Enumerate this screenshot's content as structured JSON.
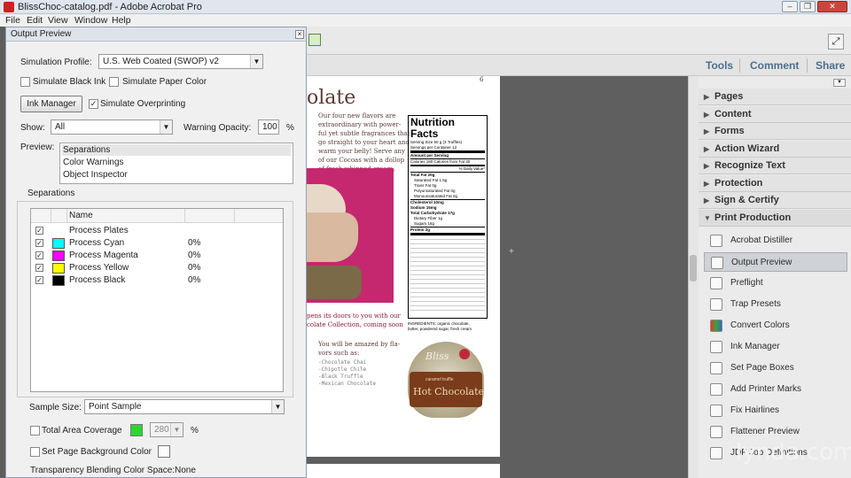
{
  "window": {
    "title": "BlissChoc-catalog.pdf - Adobe Acrobat Pro"
  },
  "menu": [
    "File",
    "Edit",
    "View",
    "Window",
    "Help"
  ],
  "command_bar": {
    "tools": "Tools",
    "comment": "Comment",
    "share": "Share"
  },
  "right_panel": {
    "sections": [
      "Pages",
      "Content",
      "Forms",
      "Action Wizard",
      "Recognize Text",
      "Protection",
      "Sign & Certify",
      "Print Production"
    ],
    "tools": [
      "Acrobat Distiller",
      "Output Preview",
      "Preflight",
      "Trap Presets",
      "Convert Colors",
      "Ink Manager",
      "Set Page Boxes",
      "Add Printer Marks",
      "Fix Hairlines",
      "Flattener Preview",
      "JDF Job Definitions"
    ],
    "selected_tool": "Output Preview"
  },
  "dialog": {
    "title": "Output Preview",
    "simulation_profile_label": "Simulation Profile:",
    "simulation_profile": "U.S. Web Coated (SWOP) v2",
    "simulate_black_ink": "Simulate Black Ink",
    "simulate_paper_color": "Simulate Paper Color",
    "ink_manager_button": "Ink Manager",
    "simulate_overprinting": "Simulate Overprinting",
    "show_label": "Show:",
    "show_value": "All",
    "warning_opacity_label": "Warning Opacity:",
    "warning_opacity_value": "100",
    "percent": "%",
    "preview_label": "Preview:",
    "preview_options": [
      "Separations",
      "Color Warnings",
      "Object Inspector"
    ],
    "separations_label": "Separations",
    "name_header": "Name",
    "separations": [
      {
        "name": "Process Plates",
        "pct": "",
        "color": ""
      },
      {
        "name": "Process Cyan",
        "pct": "0%",
        "color": "#00ffff"
      },
      {
        "name": "Process Magenta",
        "pct": "0%",
        "color": "#ff00ff"
      },
      {
        "name": "Process Yellow",
        "pct": "0%",
        "color": "#ffff00"
      },
      {
        "name": "Process Black",
        "pct": "0%",
        "color": "#000000"
      }
    ],
    "sample_size_label": "Sample Size:",
    "sample_size_value": "Point Sample",
    "total_area_coverage": "Total Area Coverage",
    "tac_value": "280",
    "set_page_bg": "Set Page Background Color",
    "transparency_label": "Transparency Blending Color Space:",
    "transparency_value": "None"
  },
  "document": {
    "page_number": "6",
    "heading": "olate",
    "intro": [
      "Our four new flavors are",
      "extraordinary with power-",
      "ful yet subtle fragrances that",
      "go straight to your heart and",
      "warm your belly! Serve any",
      "of our Cocoas with a dollop",
      "of fresh whipped cream."
    ],
    "caption": [
      "pens its doors to you with our",
      "colate Collection, coming soon"
    ],
    "amazed": [
      "You will be amazed by fla-",
      "vors such as:"
    ],
    "flavors": [
      "-Chocolate Chai",
      "-Chipotle Chile",
      "-Black Truffle",
      "-Mexican Chocolate"
    ],
    "nutrition_title": "Nutrition Facts",
    "serving_size": "Serving Size  60 g  (3 Truffles)",
    "servings": "Servings per Container 12",
    "amount": "Amount per Serving",
    "calories": "Calories   180     Calories from Fat 30",
    "dv": "% Daily Value*",
    "nutrients": [
      "Total Fat 20g",
      "Saturated Fat 1.5g",
      "Trans Fat 0g",
      "Polyunsaturated Fat 0g",
      "Monounsaturated Fat 0g",
      "Cholesterol 10mg",
      "Sodium 15mg",
      "Total Carbohydrate 17g",
      "Dietary Fiber 1g",
      "Sugars 16g",
      "Protein 2g"
    ],
    "ingredients": [
      "INGREDIENTS: organic chocolate,",
      "butter, powdered sugar, fresh cream"
    ],
    "tin_brand": "Bliss",
    "tin_label": "Hot Chocolate",
    "tin_sub": "caramel truffle"
  },
  "watermark": "lynda.com",
  "colors": {
    "accent": "#4c6f8f",
    "page_bg": "#5f5f5f",
    "magenta_photo": "#c5286f"
  }
}
